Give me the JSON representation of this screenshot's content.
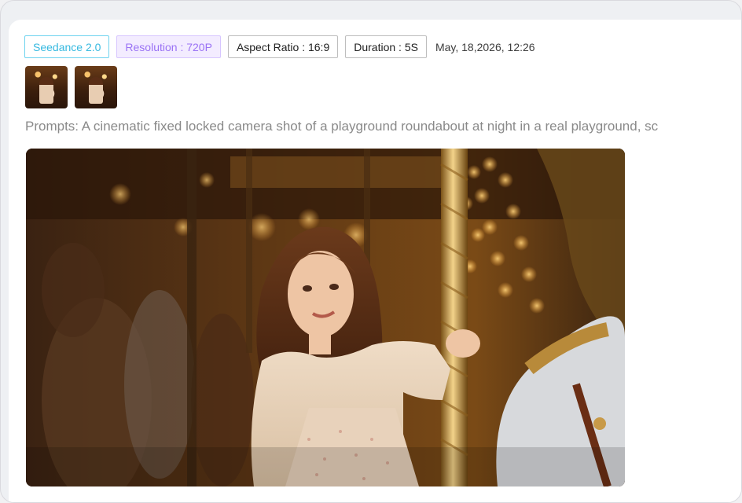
{
  "tags": {
    "model": "Seedance 2.0",
    "resolution": "Resolution : 720P",
    "aspect_ratio": "Aspect Ratio : 16:9",
    "duration": "Duration : 5S"
  },
  "timestamp": "May, 18,2026, 12:26",
  "thumbnails": [
    "reference image 1",
    "reference image 2"
  ],
  "prompt_text": "Prompts: A cinematic fixed locked camera shot of a playground roundabout at night in a real playground, sc",
  "colors": {
    "model_tag": "#36b9e0",
    "resolution_tag": "#9a72f5",
    "resolution_bg": "#f3ecff"
  }
}
